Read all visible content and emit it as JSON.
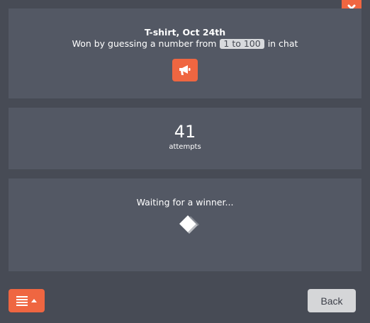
{
  "prize": {
    "title": "T-shirt, Oct 24th",
    "desc_prefix": "Won by guessing a number from",
    "range": "1 to 100",
    "desc_suffix": "in chat"
  },
  "stats": {
    "attempts_count": "41",
    "attempts_label": "attempts"
  },
  "status": {
    "waiting_text": "Waiting for a winner..."
  },
  "footer": {
    "back_label": "Back"
  },
  "icons": {
    "close": "close-icon",
    "announce": "megaphone-icon",
    "spinner": "diamond-spinner-icon",
    "menu": "list-icon",
    "caret": "caret-up-icon"
  },
  "colors": {
    "accent": "#ef6641",
    "panel": "#535864",
    "background": "#474b55",
    "back_button": "#d5d6d8"
  }
}
